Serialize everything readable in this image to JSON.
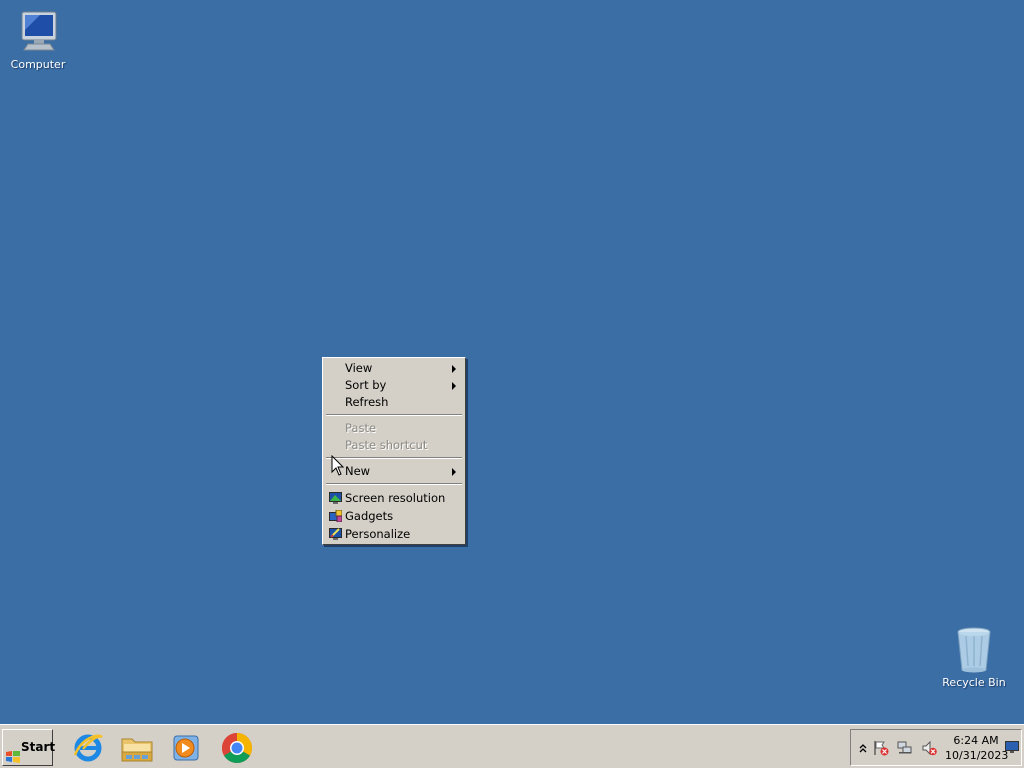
{
  "desktop": {
    "background_color": "#3b6ea5",
    "icons": [
      {
        "label": "Computer",
        "icon": "computer-icon"
      },
      {
        "label": "Recycle Bin",
        "icon": "recycle-bin-icon"
      }
    ]
  },
  "context_menu": {
    "items": [
      {
        "label": "View",
        "submenu": true,
        "enabled": true
      },
      {
        "label": "Sort by",
        "submenu": true,
        "enabled": true
      },
      {
        "label": "Refresh",
        "submenu": false,
        "enabled": true
      },
      {
        "label": "Paste",
        "submenu": false,
        "enabled": false
      },
      {
        "label": "Paste shortcut",
        "submenu": false,
        "enabled": false
      },
      {
        "label": "New",
        "submenu": true,
        "enabled": true
      },
      {
        "label": "Screen resolution",
        "submenu": false,
        "enabled": true,
        "icon": "screen-resolution-icon"
      },
      {
        "label": "Gadgets",
        "submenu": false,
        "enabled": true,
        "icon": "gadgets-icon"
      },
      {
        "label": "Personalize",
        "submenu": false,
        "enabled": true,
        "icon": "personalize-icon"
      }
    ]
  },
  "taskbar": {
    "start_label": "Start",
    "pinned": [
      {
        "name": "Internet Explorer",
        "icon": "internet-explorer-icon"
      },
      {
        "name": "Windows Explorer",
        "icon": "folder-icon"
      },
      {
        "name": "Windows Media Player",
        "icon": "media-player-icon"
      },
      {
        "name": "Google Chrome",
        "icon": "chrome-icon"
      }
    ],
    "tray": {
      "icons": [
        "show-hidden-icons-chevron",
        "action-center-flag-icon",
        "network-icon",
        "volume-muted-icon"
      ],
      "time": "6:24 AM",
      "date": "10/31/2023"
    }
  }
}
